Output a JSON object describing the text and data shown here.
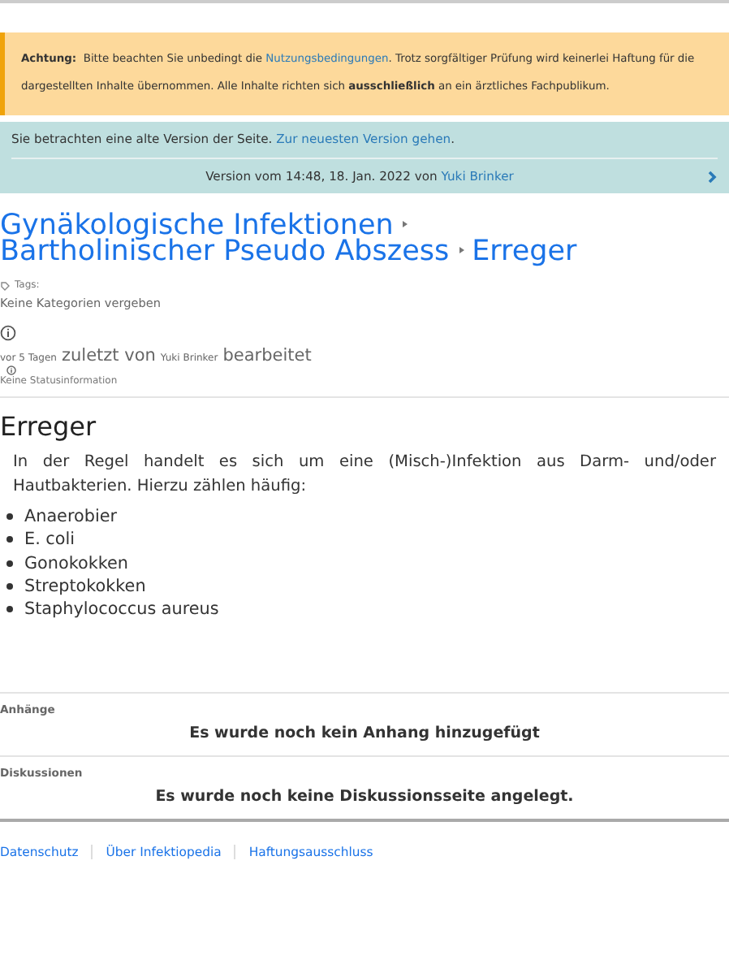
{
  "warning": {
    "label": "Achtung:",
    "text_before": "Bitte beachten Sie unbedingt die",
    "link": "Nutzungsbedingungen",
    "text_after": ". Trotz sorgfältiger Prüfung wird keinerlei Haftung für die dargestellten Inhalte übernommen. Alle Inhalte richten sich **ausschließlich** an ein ärztliches Fachpublikum."
  },
  "version_notice": {
    "text": "Sie betrachten eine alte Version der Seite.",
    "link": "Zur neuesten Version gehen",
    "link_suffix": ".",
    "version_text": "Version vom 14:48, 18. Jan. 2022 von",
    "author": "Yuki Brinker"
  },
  "breadcrumb": [
    {
      "label": "Gynäkologische Infektionen"
    },
    {
      "label": "Bartholinischer Pseudo Abszess"
    },
    {
      "label": "Erreger"
    }
  ],
  "meta": {
    "tags_label": "Tags:",
    "categories": "Keine Kategorien vergeben",
    "edited_when": "vor 5 Tagen",
    "edited_mid": "zuletzt von",
    "edited_by": "Yuki Brinker",
    "edited_end": "bearbeitet",
    "status": "Keine Statusinformation"
  },
  "article": {
    "heading": "Erreger",
    "paragraph": "In der Regel handelt es sich um eine (Misch-)Infektion aus Darm- und/oder Hautbakterien. Hierzu zählen häufig:",
    "items": [
      "Anaerobier",
      "E. coli",
      "Gonokokken",
      "Streptokokken",
      "Staphylococcus aureus"
    ]
  },
  "sections": [
    {
      "title": "Anhänge",
      "message": "Es wurde noch kein Anhang hinzugefügt"
    },
    {
      "title": "Diskussionen",
      "message": "Es wurde noch keine Diskussionsseite angelegt."
    }
  ],
  "footer_links": [
    "Datenschutz",
    "Über Infektiopedia",
    "Haftungsausschluss"
  ]
}
